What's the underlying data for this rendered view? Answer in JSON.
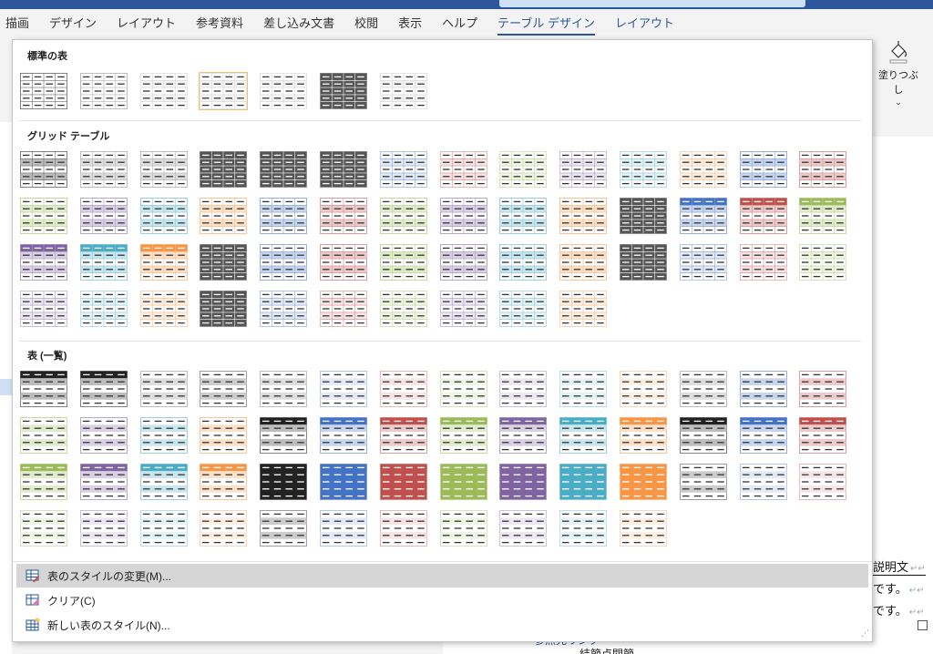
{
  "ribbon": {
    "tabs": [
      {
        "label": "描画",
        "type": "normal"
      },
      {
        "label": "デザイン",
        "type": "normal"
      },
      {
        "label": "レイアウト",
        "type": "normal"
      },
      {
        "label": "参考資料",
        "type": "normal"
      },
      {
        "label": "差し込み文書",
        "type": "normal"
      },
      {
        "label": "校閲",
        "type": "normal"
      },
      {
        "label": "表示",
        "type": "normal"
      },
      {
        "label": "ヘルプ",
        "type": "normal"
      },
      {
        "label": "テーブル デザイン",
        "type": "active"
      },
      {
        "label": "レイアウト",
        "type": "ctx"
      }
    ],
    "shading": {
      "label": "塗りつぶし",
      "icon": "paint-bucket-icon"
    }
  },
  "gallery": {
    "sections": [
      {
        "title": "標準の表",
        "tiles": [
          "plain-black",
          "plain-gray",
          "light-gray",
          "light-gray",
          "light-gray",
          "dark-gray",
          "light-gray"
        ]
      },
      {
        "title": "グリッド テーブル",
        "tiles": [
          "grid-outline-black",
          "grid-gray",
          "grid-gray",
          "grid-dark-gray",
          "grid-dark-gray",
          "grid-dark-gray",
          "grid-light-blue",
          "grid-light-red",
          "grid-light-green",
          "grid-light-purple",
          "grid-light-cyan",
          "grid-light-orange",
          "grid-blue",
          "grid-red",
          "grid-green",
          "grid-purple",
          "grid-cyan",
          "grid-orange",
          "grid-blue",
          "grid-red",
          "grid-green",
          "grid-purple",
          "grid-cyan",
          "grid-orange",
          "head-dark-gray",
          "head-blue",
          "head-red",
          "head-green",
          "head-purple",
          "head-cyan",
          "head-orange",
          "grid-dark-gray",
          "grid-blue",
          "grid-red",
          "grid-green",
          "grid-purple",
          "grid-cyan",
          "grid-orange",
          "grid-dark-gray",
          "grid-pale-blue",
          "grid-pale-red",
          "grid-pale-green",
          "grid-pale-purple",
          "grid-pale-cyan",
          "grid-pale-orange",
          "grid-dark-gray",
          "grid-pale-blue",
          "grid-pale-red",
          "grid-pale-green",
          "grid-pale-purple",
          "grid-pale-cyan",
          "grid-pale-orange"
        ]
      },
      {
        "title": "表 (一覧)",
        "tiles": [
          "list-black",
          "list-black",
          "list-gray",
          "list-dark-gray",
          "list-gray",
          "list-light-blue",
          "list-light-red",
          "list-light-green",
          "list-light-purple",
          "list-light-cyan",
          "list-light-orange",
          "list-gray",
          "list-blue",
          "list-red",
          "list-green",
          "list-purple",
          "list-cyan",
          "list-orange",
          "list-head-black",
          "list-head-blue",
          "list-head-red",
          "list-head-green",
          "list-head-purple",
          "list-head-cyan",
          "list-head-orange",
          "list-head-black",
          "list-head-blue",
          "list-head-red",
          "list-head-green",
          "list-head-purple",
          "list-head-cyan",
          "list-head-orange",
          "list-solid-black",
          "list-solid-blue",
          "list-solid-red",
          "list-solid-green",
          "list-solid-purple",
          "list-solid-cyan",
          "list-solid-orange",
          "list-dark-gray",
          "list-pale-blue",
          "list-pale-red",
          "list-pale-green",
          "list-pale-purple",
          "list-pale-cyan",
          "list-pale-orange",
          "list-dark-gray",
          "list-pale-blue",
          "list-pale-red",
          "list-pale-green",
          "list-pale-purple",
          "list-pale-cyan",
          "list-pale-orange"
        ]
      }
    ],
    "palette": {
      "black": "#222222",
      "gray": "#8c8c8c",
      "dark-gray": "#555555",
      "light-gray": "#bdbdbd",
      "blue": "#4472c4",
      "red": "#c0504d",
      "green": "#9bbb59",
      "purple": "#8064a2",
      "cyan": "#4bacc6",
      "orange": "#f79646"
    },
    "hovered_tile": {
      "section": 0,
      "index": 3
    }
  },
  "menu": {
    "items": [
      {
        "label": "表のスタイルの変更(M)...",
        "icon": "modify-table-style-icon",
        "highlighted": true
      },
      {
        "label": "クリア(C)",
        "icon": "clear-table-style-icon",
        "highlighted": false
      },
      {
        "label": "新しい表のスタイル(N)...",
        "icon": "new-table-style-icon",
        "highlighted": false
      }
    ]
  },
  "document": {
    "lines": [
      "説明文",
      "です。",
      "です。"
    ],
    "bottom_link": "参照先リンク",
    "bottom_text": "結節点関節"
  }
}
